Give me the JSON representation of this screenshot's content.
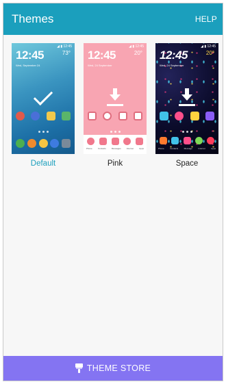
{
  "app_bar": {
    "title": "Themes",
    "help": "HELP"
  },
  "themes": [
    {
      "name": "Default",
      "selected": true,
      "preview": {
        "clock": "12:45",
        "temp": "73°",
        "date": "Wed, September 24",
        "status": "◢ ▮ 12:45"
      }
    },
    {
      "name": "Pink",
      "selected": false,
      "preview": {
        "clock": "12:45",
        "temp": "20°",
        "date": "Wed, 24 September",
        "status": "◢ ▮ 12:45",
        "labels": [
          "Phone",
          "Contacts",
          "Messages",
          "Internet",
          "Apps"
        ]
      }
    },
    {
      "name": "Space",
      "selected": false,
      "preview": {
        "clock": "12:45",
        "temp": "20°",
        "date": "Wed, 24 September",
        "status": "◢ ▮ 12:45",
        "labels": [
          "Phone",
          "Contacts",
          "Message",
          "Internet",
          "Apps"
        ]
      }
    }
  ],
  "theme_store": {
    "label": "THEME STORE"
  },
  "colors": {
    "accent": "#1b9fbd",
    "store": "#8474f2",
    "pink_bg": "#f8a5b2",
    "space_bg": "#0b0b2a"
  },
  "icons": [
    "checkmark-icon",
    "download-icon",
    "paint-brush-icon"
  ]
}
